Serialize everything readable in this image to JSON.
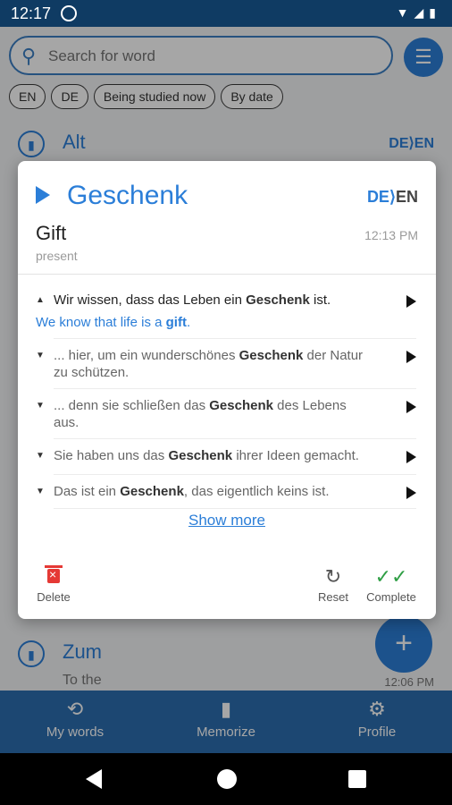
{
  "status_bar": {
    "time": "12:17"
  },
  "search": {
    "placeholder": "Search for word"
  },
  "chips": [
    "EN",
    "DE",
    "Being studied now",
    "By date"
  ],
  "background_list": [
    {
      "word": "Alt",
      "lang": "DE⟩EN"
    },
    {
      "word": "Zum",
      "sub": "To the",
      "time": "12:06 PM"
    }
  ],
  "dialog": {
    "word": "Geschenk",
    "lang_from": "DE",
    "lang_to": "EN",
    "translation": "Gift",
    "alt_translation": "present",
    "time": "12:13 PM",
    "examples": [
      {
        "pre": "Wir wissen, dass das Leben ein ",
        "bold": "Geschenk",
        "post": " ist.",
        "translation_pre": "We know that life is a ",
        "translation_bold": "gift",
        "translation_post": "."
      },
      {
        "pre": "... hier, um ein wunderschönes ",
        "bold": "Geschenk",
        "post": " der Natur zu schützen."
      },
      {
        "pre": "... denn sie schließen das ",
        "bold": "Geschenk",
        "post": " des Lebens aus."
      },
      {
        "pre": "Sie haben uns das ",
        "bold": "Geschenk",
        "post": " ihrer Ideen gemacht."
      },
      {
        "pre": "Das ist ein ",
        "bold": "Geschenk",
        "post": ", das eigentlich keins ist."
      }
    ],
    "show_more": "Show more",
    "actions": {
      "delete": "Delete",
      "reset": "Reset",
      "complete": "Complete"
    }
  },
  "bottom_nav": {
    "my_words": "My words",
    "memorize": "Memorize",
    "profile": "Profile"
  },
  "colors": {
    "accent": "#2b7ed8",
    "status_bar": "#0f3b63",
    "danger": "#e53935",
    "success": "#2e9e44"
  }
}
